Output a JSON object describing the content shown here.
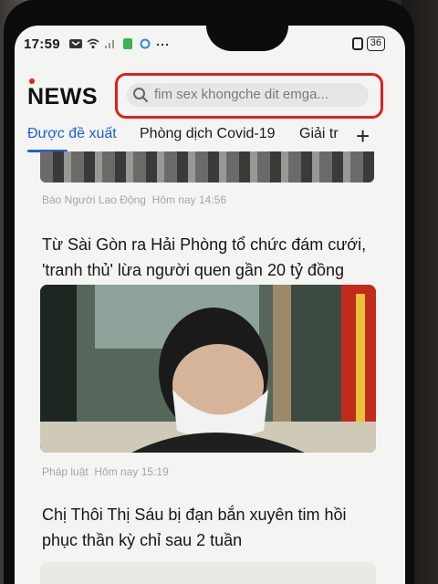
{
  "status": {
    "time": "17:59",
    "battery": "36"
  },
  "header": {
    "logo": "NEWS",
    "search_placeholder": "fim sex khongche dit emga..."
  },
  "tabs": [
    {
      "label": "Được đề xuất",
      "active": true
    },
    {
      "label": "Phòng dịch Covid-19",
      "active": false
    },
    {
      "label": "Giải tr",
      "active": false
    }
  ],
  "articles": [
    {
      "source": "Báo Người Lao Động",
      "time": "Hôm nay 14:56",
      "title_line1": "Từ Sài Gòn ra Hải Phòng tổ chức đám cưới,",
      "title_line2": "'tranh thủ' lừa người quen gần 20 tỷ đồng"
    },
    {
      "source": "Pháp luật",
      "time": "Hôm nay 15:19",
      "title_line1": "Chị Thôi Thị Sáu bị đạn bắn xuyên tim hồi",
      "title_line2": "phục thần kỳ chỉ sau 2 tuần"
    }
  ],
  "colors": {
    "accent": "#1f5ed8",
    "highlight": "#e02020",
    "logo_dot": "#e0212b"
  }
}
